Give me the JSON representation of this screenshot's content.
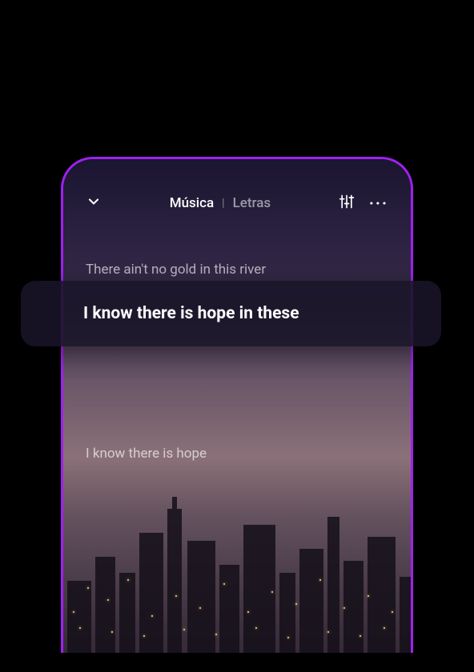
{
  "header": {
    "tab_music": "Música",
    "tab_lyrics": "Letras",
    "divider": "|"
  },
  "lyrics": {
    "prev": "There ain't no gold in this river",
    "current": "I know there is hope in these",
    "next": "I know there is hope"
  },
  "icons": {
    "chevron": "chevron-down-icon",
    "equalizer": "equalizer-icon",
    "more": "more-icon"
  }
}
